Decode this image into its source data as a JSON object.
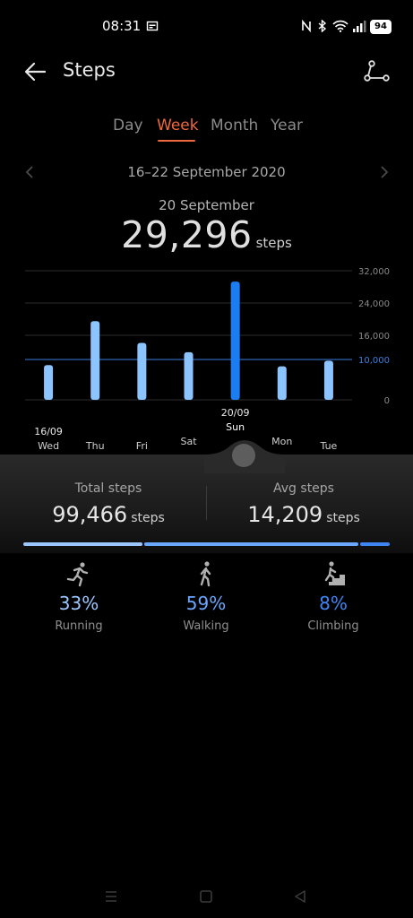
{
  "status_bar": {
    "time": "08:31",
    "battery": "94"
  },
  "header": {
    "title": "Steps"
  },
  "tabs": [
    {
      "label": "Day",
      "active": false
    },
    {
      "label": "Week",
      "active": true
    },
    {
      "label": "Month",
      "active": false
    },
    {
      "label": "Year",
      "active": false
    }
  ],
  "range_label": "16–22 September 2020",
  "selected": {
    "date": "20 September",
    "steps": "29,296",
    "unit": "steps"
  },
  "chart_data": {
    "type": "bar",
    "categories": [
      "Wed",
      "Thu",
      "Fri",
      "Sat",
      "Sun",
      "Mon",
      "Tue"
    ],
    "dates": [
      "16/09",
      "",
      "",
      "",
      "20/09",
      "",
      ""
    ],
    "values": [
      8600,
      19500,
      14100,
      11800,
      29296,
      8300,
      9700
    ],
    "selected_index": 4,
    "y_ticks": [
      {
        "value": 0,
        "label": "0"
      },
      {
        "value": 10000,
        "label": "10,000"
      },
      {
        "value": 16000,
        "label": "16,000"
      },
      {
        "value": 24000,
        "label": "24,000"
      },
      {
        "value": 32000,
        "label": "32,000"
      }
    ],
    "goal": 10000,
    "ylim": [
      0,
      32000
    ],
    "colors": {
      "bar": "#8cc4ff",
      "selected_bar": "#1a7ef2",
      "goal": "#3d7fe0",
      "grid": "#2b2b2b"
    }
  },
  "summary": {
    "total_label": "Total steps",
    "total_value": "99,466",
    "total_unit": "steps",
    "avg_label": "Avg steps",
    "avg_value": "14,209",
    "avg_unit": "steps"
  },
  "breakdown": [
    {
      "label": "Running",
      "percent": "33%",
      "share": 0.33,
      "icon": "running-icon",
      "color": "#9cc6ff"
    },
    {
      "label": "Walking",
      "percent": "59%",
      "share": 0.59,
      "icon": "walking-icon",
      "color": "#6aa8ff"
    },
    {
      "label": "Climbing",
      "percent": "8%",
      "share": 0.08,
      "icon": "climbing-icon",
      "color": "#3f86f5"
    }
  ]
}
